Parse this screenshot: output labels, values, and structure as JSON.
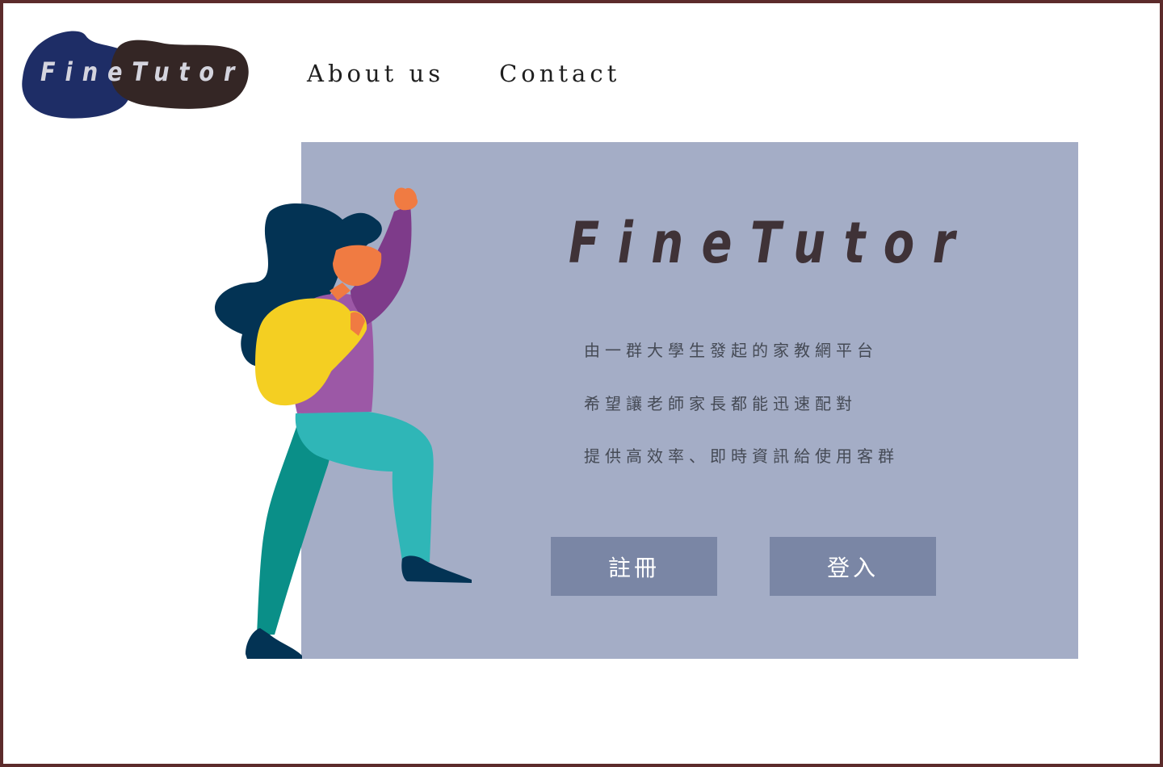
{
  "brand": {
    "logo_text": "FineTutor"
  },
  "nav": {
    "items": [
      {
        "label": "About us"
      },
      {
        "label": "Contact"
      }
    ]
  },
  "hero": {
    "title": "FineTutor",
    "description": [
      "由一群大學生發起的家教網平台",
      "希望讓老師家長都能迅速配對",
      "提供高效率、即時資訊給使用客群"
    ],
    "buttons": {
      "register": "註冊",
      "login": "登入"
    }
  },
  "colors": {
    "border": "#5c2b2b",
    "panel": "#a4adc6",
    "button": "#7a86a5",
    "logo_blob_blue": "#1e2d66",
    "logo_blob_brown": "#342625",
    "title_text": "#3f3237"
  },
  "icons": [
    "hiker-illustration"
  ]
}
